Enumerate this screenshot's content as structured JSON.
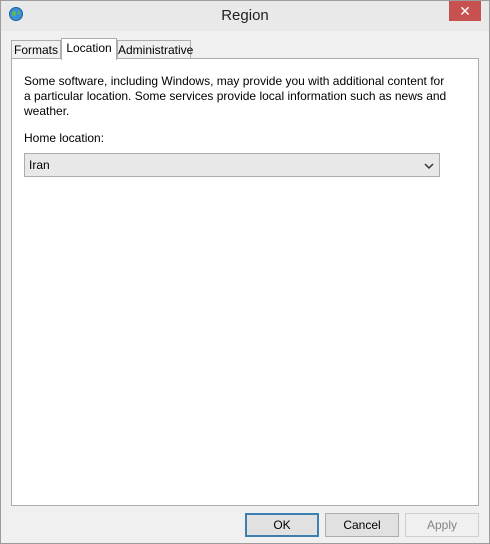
{
  "window": {
    "title": "Region",
    "close_glyph": "✕"
  },
  "tabs": [
    {
      "label": "Formats",
      "active": false
    },
    {
      "label": "Location",
      "active": true
    },
    {
      "label": "Administrative",
      "active": false
    }
  ],
  "location": {
    "description": "Some software, including Windows, may provide you with additional content for a particular location. Some services provide local information such as news and weather.",
    "home_label": "Home location:",
    "home_value": "Iran"
  },
  "buttons": {
    "ok": "OK",
    "cancel": "Cancel",
    "apply": "Apply"
  },
  "icons": {
    "app": "globe-icon",
    "close": "close-icon",
    "dropdown": "chevron-down-icon"
  },
  "colors": {
    "close_button": "#c75050",
    "default_button_border": "#3c7fb1"
  }
}
